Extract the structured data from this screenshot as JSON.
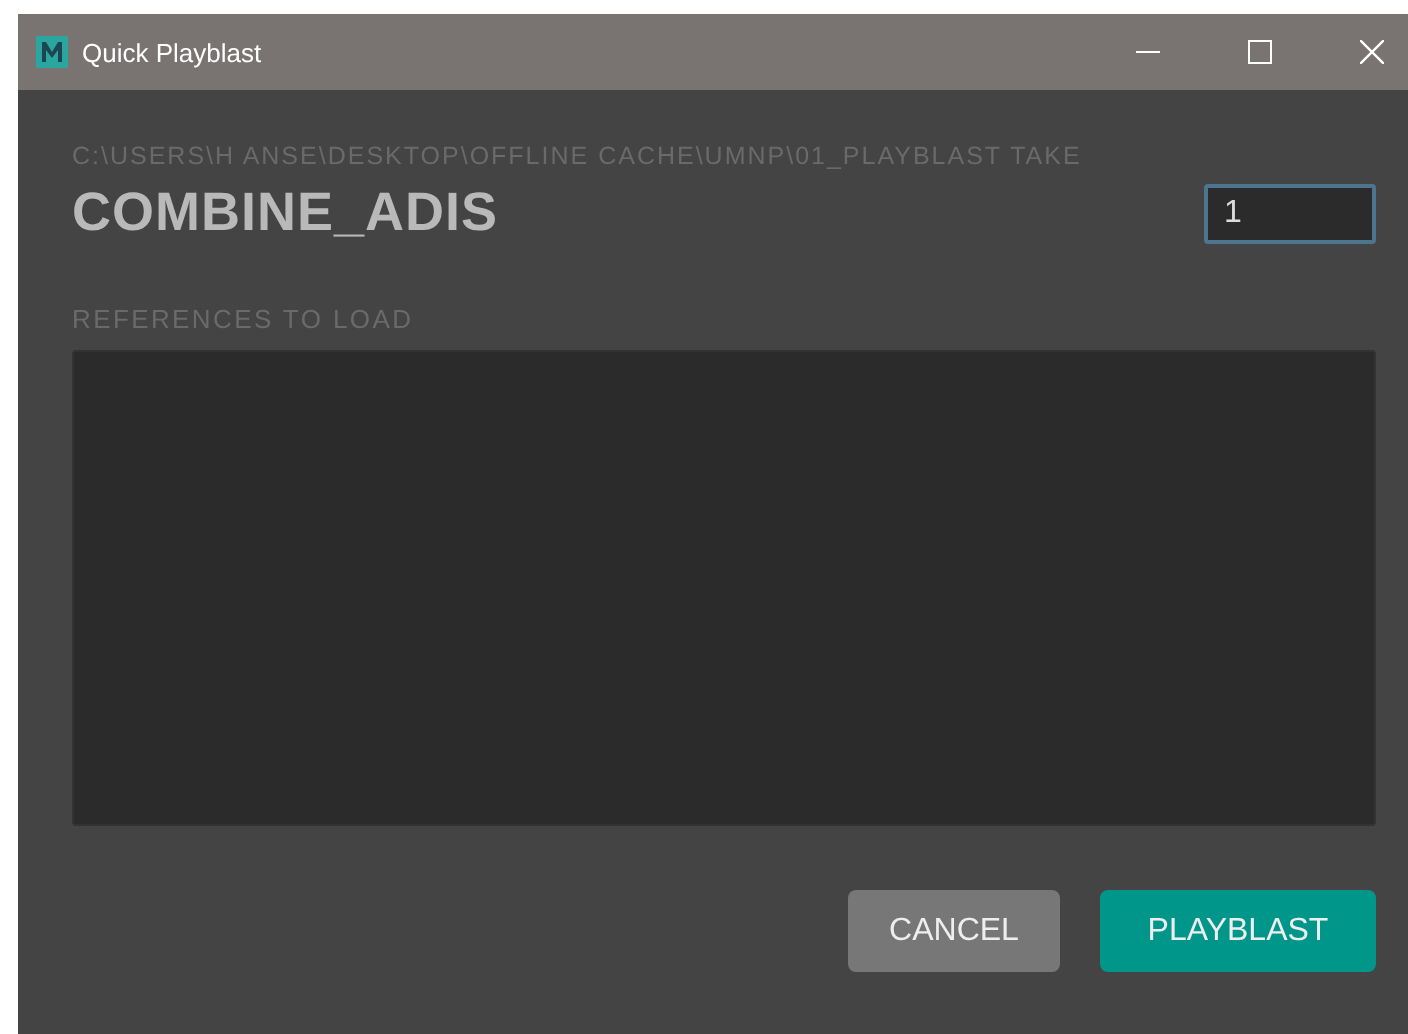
{
  "window": {
    "title": "Quick Playblast"
  },
  "path": "C:\\USERS\\H ANSE\\DESKTOP\\OFFLINE CACHE\\UMNP\\01_PLAYBLAST TAKE",
  "scene_name": "COMBINE_ADIS",
  "take_field": {
    "value": "1"
  },
  "references": {
    "label": "REFERENCES TO LOAD"
  },
  "buttons": [
    {
      "label": "CANCEL",
      "kind": "secondary"
    },
    {
      "label": "PLAYBLAST",
      "kind": "primary"
    }
  ]
}
